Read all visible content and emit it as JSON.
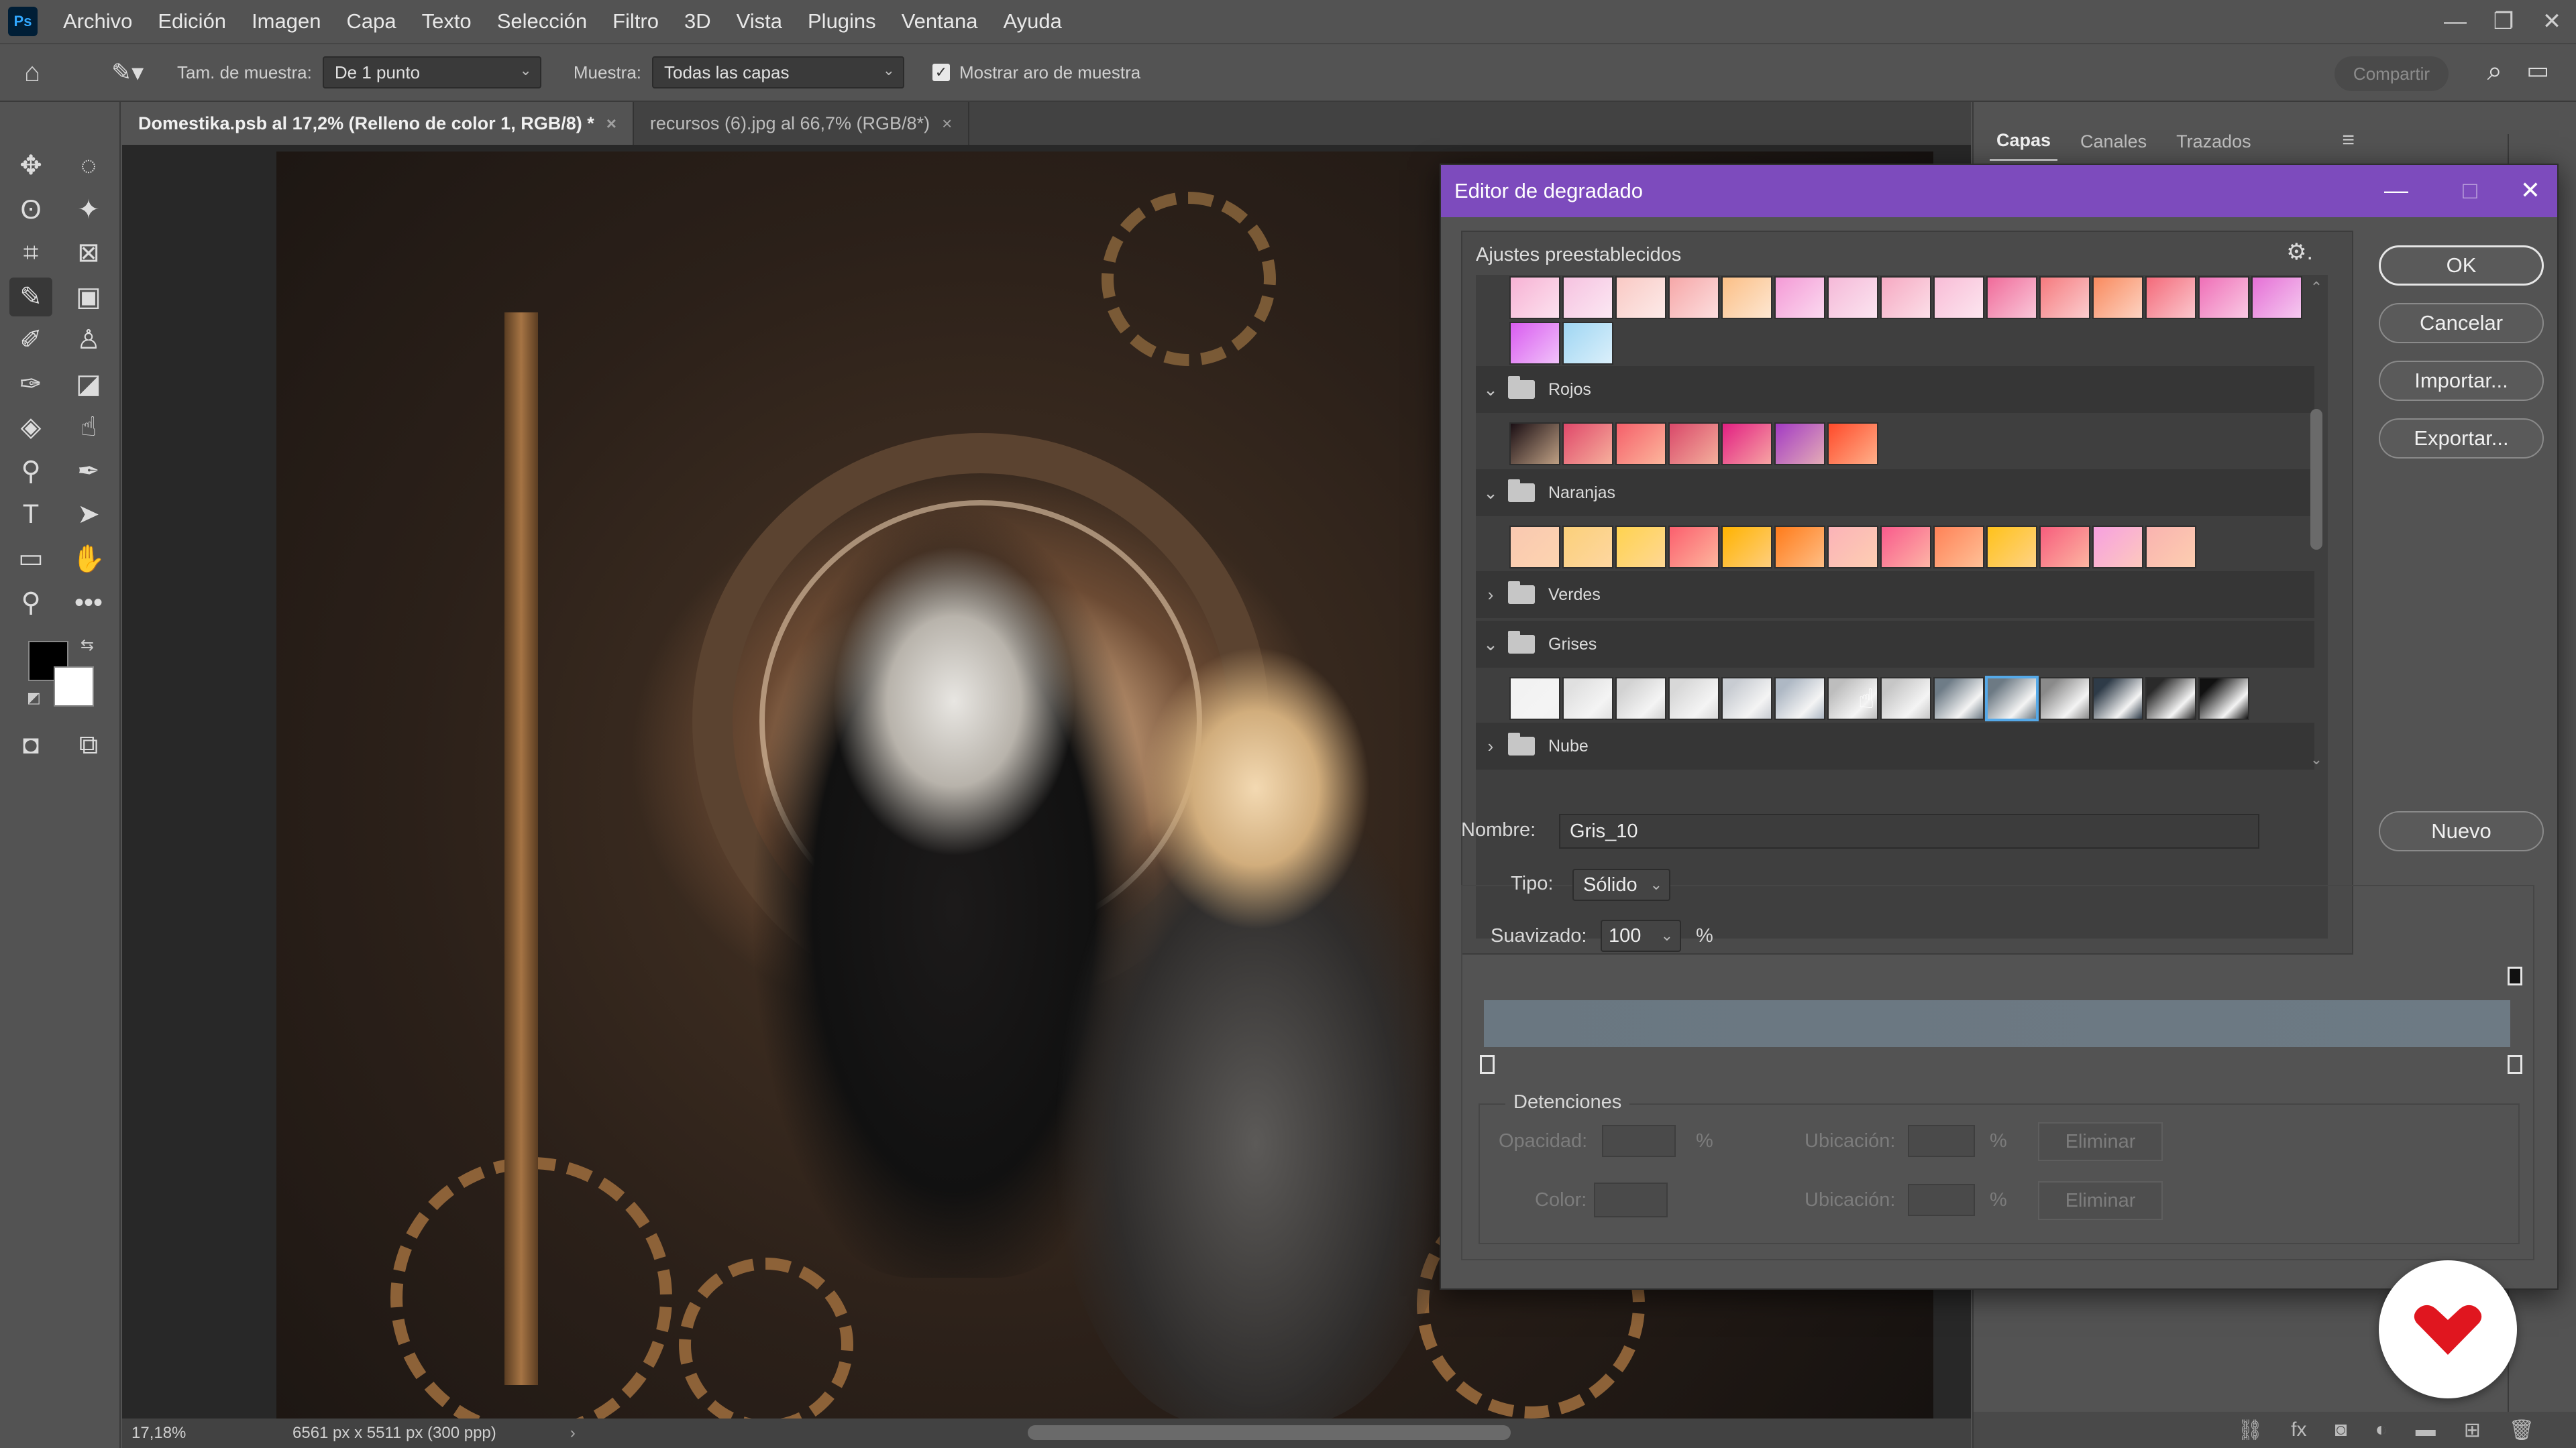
{
  "app": {
    "logo_text": "Ps"
  },
  "menu": [
    "Archivo",
    "Edición",
    "Imagen",
    "Capa",
    "Texto",
    "Selección",
    "Filtro",
    "3D",
    "Vista",
    "Plugins",
    "Ventana",
    "Ayuda"
  ],
  "options": {
    "sample_size_label": "Tam. de muestra:",
    "sample_size_value": "De 1 punto",
    "sample_label": "Muestra:",
    "sample_value": "Todas las capas",
    "show_ring_label": "Mostrar aro de muestra",
    "share_label": "Compartir"
  },
  "tabs": [
    {
      "label": "Domestika.psb al 17,2% (Relleno de color 1, RGB/8) *",
      "active": true
    },
    {
      "label": "recursos (6).jpg al 66,7% (RGB/8*)",
      "active": false
    }
  ],
  "status": {
    "zoom": "17,18%",
    "doc_size": "6561 px x 5511 px (300 ppp)"
  },
  "panel_tabs": [
    "Capas",
    "Canales",
    "Trazados"
  ],
  "dialog": {
    "title": "Editor de degradado",
    "presets_label": "Ajustes preestablecidos",
    "groups": [
      {
        "name": "Rojos",
        "expanded": true
      },
      {
        "name": "Naranjas",
        "expanded": true
      },
      {
        "name": "Verdes",
        "expanded": false
      },
      {
        "name": "Grises",
        "expanded": true
      },
      {
        "name": "Nube",
        "expanded": false
      }
    ],
    "swatches": {
      "pink_row1": [
        "#f7b2d4",
        "#f6c2e0",
        "#f9c9c4",
        "#f6a7a8",
        "#fbbf86",
        "#f49ad6",
        "#f5b9d8",
        "#f6a9c2",
        "#f8bcd6",
        "#f06b9a",
        "#f57a7e",
        "#f98a5e",
        "#f46a7a",
        "#ef6fb7",
        "#e570d6"
      ],
      "pink_row2": [
        "#d95cf0",
        "#9fd6f3"
      ],
      "reds": [
        "#1b0f14",
        "#e0486a",
        "#f55f6a",
        "#d9486a",
        "#e21f82",
        "#a23ac4",
        "#ff4a2a"
      ],
      "oranges": [
        "#f9c8b0",
        "#fbd07a",
        "#ffd34f",
        "#fb5f6e",
        "#ffb300",
        "#ff7b1a",
        "#fbb3b8",
        "#f95a8c",
        "#ff8257",
        "#ffc21a",
        "#f75d7d",
        "#f7a0e0",
        "#f9b3b0"
      ],
      "grays": [
        "#f2f2f2",
        "#e0e0e0",
        "#d2d2d2",
        "#d8d8d8",
        "#c8ccd2",
        "#aeb8c4",
        "#bdbdbd",
        "#c6c6c6",
        "#6e7c87",
        "#6d7a84",
        "#8a8a8a",
        "#2e3b48",
        "#2a2a2a",
        "#111111"
      ],
      "selected_gray_index": 9
    },
    "buttons": {
      "ok": "OK",
      "cancel": "Cancelar",
      "import": "Importar...",
      "export": "Exportar...",
      "new": "Nuevo"
    },
    "name_label": "Nombre:",
    "name_value": "Gris_10",
    "type_label": "Tipo:",
    "type_value": "Sólido",
    "smooth_label": "Suavizado:",
    "smooth_value": "100",
    "percent": "%",
    "gradient_colors": {
      "left": "#6a7781",
      "right": "#6d7a84"
    },
    "stops": {
      "title": "Detenciones",
      "opacity_label": "Opacidad:",
      "location_label": "Ubicación:",
      "color_label": "Color:",
      "delete_label": "Eliminar"
    }
  },
  "colors": {
    "accent": "#7d4bbd",
    "watermark": "#e0161f"
  }
}
